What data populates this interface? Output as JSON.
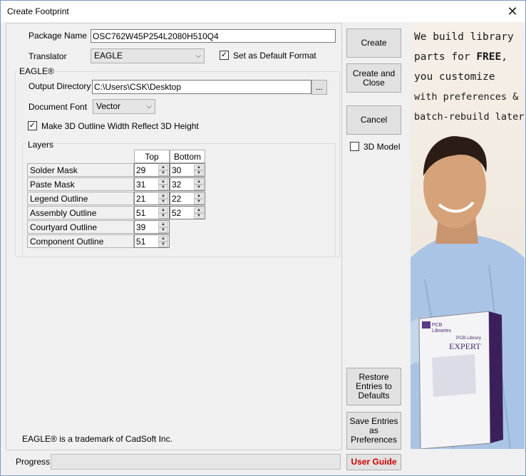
{
  "window": {
    "title": "Create Footprint",
    "close_glyph": "✕"
  },
  "form": {
    "package_name_label": "Package Name",
    "package_name_value": "OSC762W45P254L2080H510Q4",
    "translator_label": "Translator",
    "translator_value": "EAGLE",
    "set_default_label": "Set as Default Format",
    "set_default_checked": true
  },
  "eagle": {
    "group_title": "EAGLE®",
    "output_dir_label": "Output Directory",
    "output_dir_value": "C:\\Users\\CSK\\Desktop",
    "browse_label": "...",
    "document_font_label": "Document Font",
    "document_font_value": "Vector",
    "make3d_label": "Make 3D Outline Width Reflect 3D Height",
    "make3d_checked": true,
    "trademark": "EAGLE® is a trademark of CadSoft Inc."
  },
  "layers": {
    "group_title": "Layers",
    "col_top": "Top",
    "col_bottom": "Bottom",
    "rows": [
      {
        "label": "Solder Mask",
        "top": "29",
        "bottom": "30"
      },
      {
        "label": "Paste Mask",
        "top": "31",
        "bottom": "32"
      },
      {
        "label": "Legend Outline",
        "top": "21",
        "bottom": "22"
      },
      {
        "label": "Assembly Outline",
        "top": "51",
        "bottom": "52"
      },
      {
        "label": "Courtyard Outline",
        "top": "39"
      },
      {
        "label": "Component Outline",
        "top": "51"
      }
    ]
  },
  "buttons": {
    "create": "Create",
    "create_close_1": "Create and",
    "create_close_2": "Close",
    "cancel": "Cancel",
    "model3d_label": "3D Model",
    "restore_1": "Restore",
    "restore_2": "Entries to",
    "restore_3": "Defaults",
    "save_1": "Save Entries",
    "save_2": "as",
    "save_3": "Preferences",
    "user_guide": "User Guide"
  },
  "progress": {
    "label": "Progress"
  },
  "ad": {
    "line1": "We build library",
    "line2_a": "parts for ",
    "line2_b": "FREE",
    "line2_c": ",",
    "line3": "you customize",
    "line4": "with preferences &",
    "line5": "batch-rebuild later!",
    "box_brand_1": "PCB",
    "box_brand_2": "Libraries",
    "box_product_1": "PCB Library",
    "box_product_2": "EXPERT"
  },
  "colors": {
    "user_guide_text": "#cc0000",
    "box_purple": "#4a2a6e"
  }
}
